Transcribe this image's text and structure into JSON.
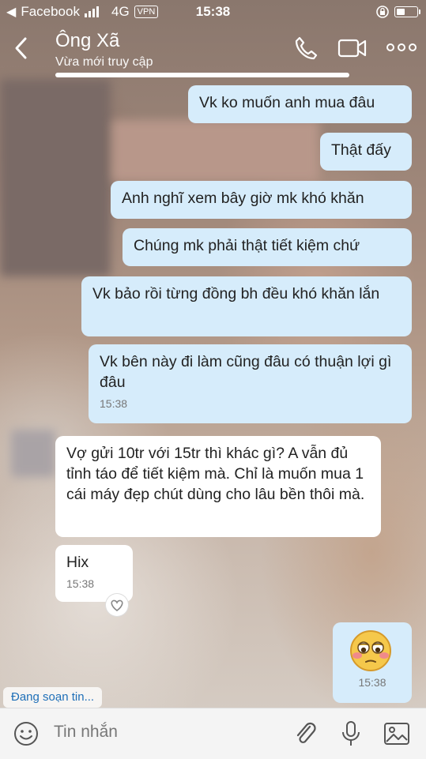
{
  "status_bar": {
    "carrier": "Facebook",
    "network": "4G",
    "vpn": "VPN",
    "time": "15:38"
  },
  "header": {
    "contact_name": "Ông Xã",
    "contact_status": "Vừa mới truy cập"
  },
  "messages": [
    {
      "side": "out",
      "text": "Vk ko muốn anh mua đâu"
    },
    {
      "side": "out",
      "text": "Thật đấy"
    },
    {
      "side": "out",
      "text": "Anh nghĩ xem bây giờ mk khó khăn"
    },
    {
      "side": "out",
      "text": "Chúng mk phải thật tiết kiệm chứ"
    },
    {
      "side": "out",
      "text": "Vk bảo rồi từng đồng bh đều khó khăn lắn"
    },
    {
      "side": "out",
      "text": "Vk bên này đi làm cũng đâu có thuận lợi gì đâu",
      "time": "15:38"
    },
    {
      "side": "in",
      "text": "Vợ gửi 10tr với 15tr thì khác gì? A vẫn đủ tỉnh táo để tiết kiệm mà. Chỉ là muốn mua 1 cái máy đẹp chút dùng cho lâu bền thôi mà."
    },
    {
      "side": "in",
      "text": "Hix",
      "time": "15:38"
    },
    {
      "side": "out",
      "sticker": "flushed-face-emoji",
      "time": "15:38"
    }
  ],
  "typing_indicator": "Đang soạn tin...",
  "composer": {
    "placeholder": "Tin nhắn"
  },
  "colors": {
    "outgoing_bubble": "#d6ecfb",
    "incoming_bubble": "#ffffff",
    "typing_text": "#1f6fb8"
  }
}
